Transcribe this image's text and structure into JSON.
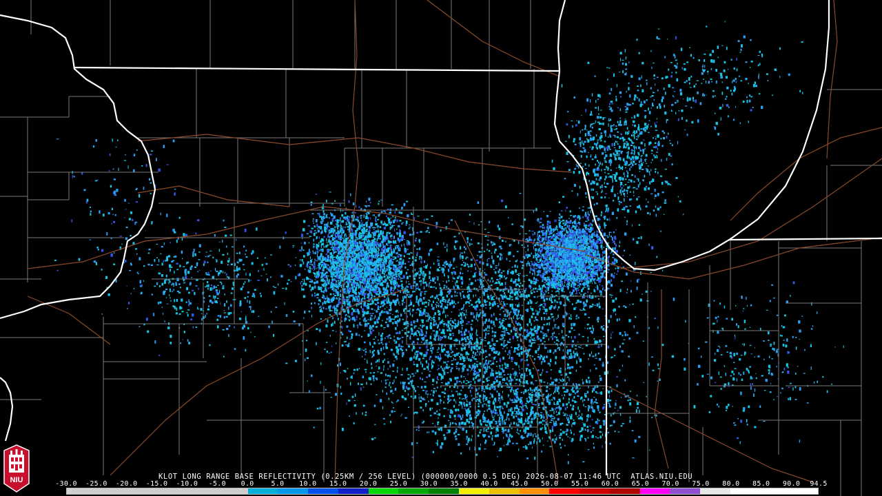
{
  "product": {
    "caption": "KLOT LONG RANGE BASE REFLECTIVITY (0.25KM / 256 LEVEL) (000000/0000 0.5 DEG) 2026-08-07 11:46 UTC  ATLAS.NIU.EDU"
  },
  "colorbar": {
    "labels": [
      "-30.0",
      "-25.0",
      "-20.0",
      "-15.0",
      "-10.0",
      "-5.0",
      "0.0",
      "5.0",
      "10.0",
      "15.0",
      "20.0",
      "25.0",
      "30.0",
      "35.0",
      "40.0",
      "45.0",
      "50.0",
      "55.0",
      "60.0",
      "65.0",
      "70.0",
      "75.0",
      "80.0",
      "85.0",
      "90.0",
      "94.5"
    ],
    "min": -30.0,
    "max": 94.5,
    "stops": [
      {
        "from": -30,
        "to": 0,
        "color": "#cfcfcf"
      },
      {
        "from": 0,
        "to": 5,
        "color": "#00b0d8"
      },
      {
        "from": 5,
        "to": 10,
        "color": "#0098e8"
      },
      {
        "from": 10,
        "to": 15,
        "color": "#0050f0"
      },
      {
        "from": 15,
        "to": 20,
        "color": "#1020c8"
      },
      {
        "from": 20,
        "to": 25,
        "color": "#00d800"
      },
      {
        "from": 25,
        "to": 30,
        "color": "#00a800"
      },
      {
        "from": 30,
        "to": 35,
        "color": "#008000"
      },
      {
        "from": 35,
        "to": 40,
        "color": "#f0f000"
      },
      {
        "from": 40,
        "to": 45,
        "color": "#e8c000"
      },
      {
        "from": 45,
        "to": 50,
        "color": "#ff9000"
      },
      {
        "from": 50,
        "to": 55,
        "color": "#ff0000"
      },
      {
        "from": 55,
        "to": 60,
        "color": "#d00000"
      },
      {
        "from": 60,
        "to": 65,
        "color": "#b00000"
      },
      {
        "from": 65,
        "to": 70,
        "color": "#ff00ff"
      },
      {
        "from": 70,
        "to": 75,
        "color": "#9050d0"
      },
      {
        "from": 75,
        "to": 80,
        "color": "#e8e8e8"
      },
      {
        "from": 80,
        "to": 94.5,
        "color": "#ffffff"
      }
    ]
  },
  "logo": {
    "text": "NIU",
    "color": "#c8102e"
  },
  "colors": {
    "state_border": "#ffffff",
    "county_border": "#808080",
    "road": "#8b4a2b",
    "echo_light": "#19c3e6",
    "echo_medium": "#2a9ef0",
    "echo_strong": "#3557e8"
  }
}
